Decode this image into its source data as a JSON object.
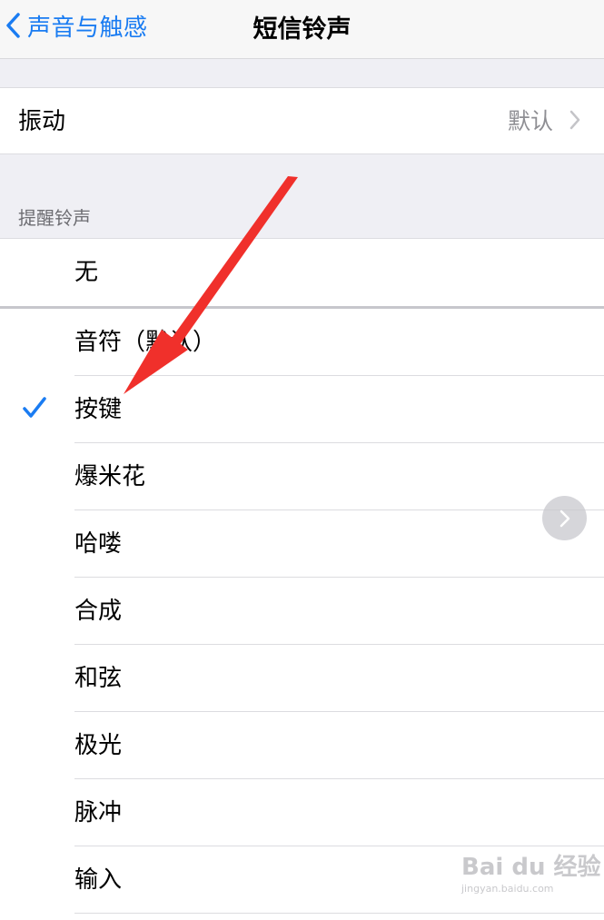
{
  "nav": {
    "back_label": "声音与触感",
    "title": "短信铃声"
  },
  "vibration": {
    "label": "振动",
    "value": "默认"
  },
  "section_header": "提醒铃声",
  "tones": [
    {
      "label": "无",
      "selected": false
    },
    {
      "label": "音符（默认）",
      "selected": false
    },
    {
      "label": "按键",
      "selected": true
    },
    {
      "label": "爆米花",
      "selected": false
    },
    {
      "label": "哈喽",
      "selected": false
    },
    {
      "label": "合成",
      "selected": false
    },
    {
      "label": "和弦",
      "selected": false
    },
    {
      "label": "极光",
      "selected": false
    },
    {
      "label": "脉冲",
      "selected": false
    },
    {
      "label": "输入",
      "selected": false
    }
  ],
  "watermark": {
    "logo": "Bai du 经验",
    "url": "jingyan.baidu.com"
  },
  "colors": {
    "accent": "#1a7cf2",
    "annotation_arrow": "#f0302b"
  },
  "icons": {
    "back": "chevron-left-icon",
    "disclosure": "chevron-right-icon",
    "selected": "checkmark-icon",
    "forward": "chevron-right-icon"
  }
}
